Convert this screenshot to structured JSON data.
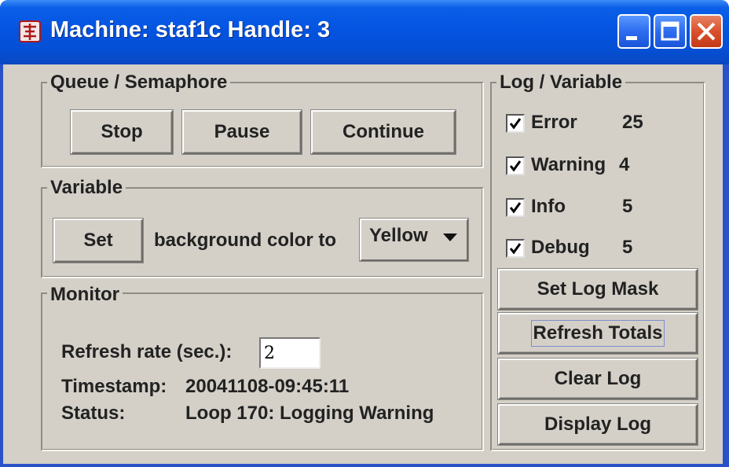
{
  "window": {
    "title": "Machine: staf1c Handle: 3"
  },
  "queue": {
    "label": "Queue / Semaphore",
    "stop": "Stop",
    "pause": "Pause",
    "continue": "Continue"
  },
  "variable": {
    "label": "Variable",
    "set": "Set",
    "text": "background color to",
    "color_selected": "Yellow"
  },
  "monitor": {
    "label": "Monitor",
    "refresh_label": "Refresh rate (sec.):",
    "refresh_value": "2",
    "timestamp_label": "Timestamp:",
    "timestamp_value": "20041108-09:45:11",
    "status_label": "Status:",
    "status_value": "Loop 170: Logging Warning"
  },
  "log": {
    "label": "Log / Variable",
    "items": [
      {
        "name": "Error",
        "count": "25",
        "checked": true
      },
      {
        "name": "Warning",
        "count": "4",
        "checked": true
      },
      {
        "name": "Info",
        "count": "5",
        "checked": true
      },
      {
        "name": "Debug",
        "count": "5",
        "checked": true
      }
    ],
    "set_mask": "Set Log Mask",
    "refresh_totals": "Refresh Totals",
    "clear": "Clear Log",
    "display": "Display Log"
  },
  "colors": {
    "titlebar": "#0454e1",
    "panel": "#d4d0c8",
    "close_button": "#d9512c"
  }
}
